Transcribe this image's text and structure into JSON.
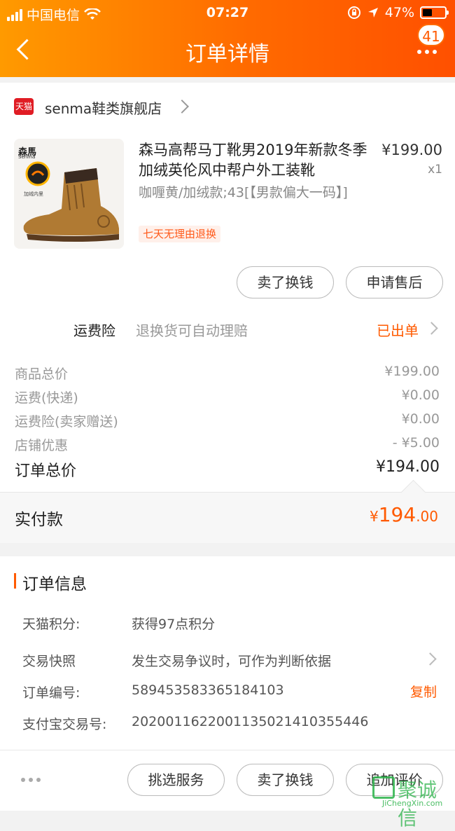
{
  "status_bar": {
    "carrier": "中国电信",
    "time": "07:27",
    "battery": "47%"
  },
  "header": {
    "title": "订单详情",
    "badge_count": "41"
  },
  "shop": {
    "logo_text": "天猫",
    "name": "senma鞋类旗舰店"
  },
  "product": {
    "title": "森马高帮马丁靴男2019年新款冬季加绒英伦风中帮户外工装靴",
    "price": "¥199.00",
    "qty": "x1",
    "sku": "咖喱黄/加绒款;43[【男款偏大一码】]",
    "return_tag": "七天无理由退换",
    "brand_text": "森馬",
    "brand_sub": "Senma",
    "badge_text": "加绒内里"
  },
  "actions": {
    "sell_exchange": "卖了换钱",
    "after_sale": "申请售后"
  },
  "insurance": {
    "label": "运费险",
    "desc": "退换货可自动理赔",
    "status": "已出单"
  },
  "fees": [
    {
      "label": "商品总价",
      "value": "¥199.00"
    },
    {
      "label": "运费(快递)",
      "value": "¥0.00"
    },
    {
      "label": "运费险(卖家赠送)",
      "value": "¥0.00"
    },
    {
      "label": "店铺优惠",
      "value": "- ¥5.00"
    }
  ],
  "total": {
    "label": "订单总价",
    "value": "¥194.00"
  },
  "paid": {
    "label": "实付款",
    "currency": "¥",
    "integer": "194",
    "decimal": ".00"
  },
  "order_info": {
    "title": "订单信息",
    "rows": [
      {
        "key": "天猫积分:",
        "value": "获得97点积分"
      },
      {
        "key": "交易快照",
        "value": "发生交易争议时，可作为判断依据"
      },
      {
        "key": "订单编号:",
        "value": "589453583365184103"
      },
      {
        "key": "支付宝交易号:",
        "value": "2020011622001135021410355446"
      }
    ],
    "copy_label": "复制"
  },
  "bottom_bar": {
    "service_label": "挑选服务",
    "sell_label": "卖了换钱",
    "review_label": "追加评价"
  },
  "watermark": {
    "text": "聚诚信",
    "url": "JiChengXin.com"
  },
  "colors": {
    "accent": "#ff5a00",
    "header_start": "#ff9a00",
    "header_end": "#ff5000",
    "tmall_red": "#e01c24"
  }
}
